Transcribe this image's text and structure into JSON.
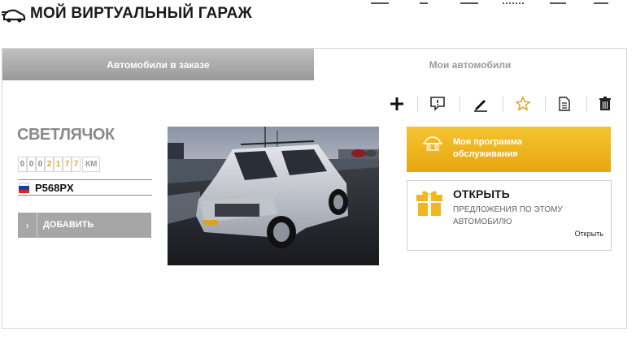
{
  "header": {
    "title": "МОЙ ВИРТУАЛЬНЫЙ ГАРАЖ",
    "logo_icon": "car-speed-icon"
  },
  "tabs": [
    {
      "label": "Автомобили в заказе",
      "active": true
    },
    {
      "label": "Мои автомобили",
      "active": false
    }
  ],
  "toolbar": {
    "items": [
      "plus-icon",
      "comment-icon",
      "pencil-icon",
      "star-icon",
      "document-icon",
      "trash-icon"
    ]
  },
  "car": {
    "name": "СВЕТЛЯЧОК",
    "odometer_digits": [
      "0",
      "0",
      "0",
      "2",
      "1",
      "7",
      "7"
    ],
    "odometer_unit": "КМ",
    "plate": "P568PX",
    "add_label": "ДОБАВИТЬ"
  },
  "service": {
    "label": "Моя программа обслуживания"
  },
  "offer": {
    "title": "ОТКРЫТЬ",
    "subtitle": "предложения по этому автомобилю",
    "link": "Открыть"
  },
  "colors": {
    "accent": "#f2b71f",
    "tab_active": "#a8a8a8"
  }
}
